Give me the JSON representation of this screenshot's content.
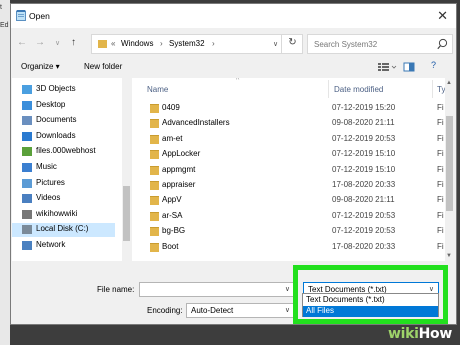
{
  "window": {
    "title": "Open"
  },
  "edge_text": [
    "t",
    "Ed"
  ],
  "address": {
    "crumbs": [
      "Windows",
      "System32"
    ]
  },
  "search": {
    "placeholder": "Search System32"
  },
  "toolbar": {
    "organize_label": "Organize ▾",
    "new_folder_label": "New folder"
  },
  "nav_items": [
    {
      "label": "3D Objects",
      "icon": "cube-icon",
      "color": "#4a9fe0"
    },
    {
      "label": "Desktop",
      "icon": "desktop-icon",
      "color": "#3b8edb"
    },
    {
      "label": "Documents",
      "icon": "documents-icon",
      "color": "#6a8fbf"
    },
    {
      "label": "Downloads",
      "icon": "download-icon",
      "color": "#2a7ad0"
    },
    {
      "label": "files.000webhost",
      "icon": "network-drive-icon",
      "color": "#5aa03a"
    },
    {
      "label": "Music",
      "icon": "music-icon",
      "color": "#3b7fd0"
    },
    {
      "label": "Pictures",
      "icon": "pictures-icon",
      "color": "#5b9bd5"
    },
    {
      "label": "Videos",
      "icon": "videos-icon",
      "color": "#4a7fc0"
    },
    {
      "label": "wikihowwiki",
      "icon": "drive-icon",
      "color": "#777777"
    },
    {
      "label": "Local Disk (C:)",
      "icon": "disk-icon",
      "color": "#7a8a99",
      "selected": true
    },
    {
      "label": "Network",
      "icon": "network-icon",
      "color": "#4a80c0"
    }
  ],
  "columns": {
    "name": "Name",
    "date": "Date modified",
    "type": "Ty"
  },
  "files": [
    {
      "name": "0409",
      "date": "07-12-2019 15:20",
      "type": "Fi"
    },
    {
      "name": "AdvancedInstallers",
      "date": "09-08-2020 21:11",
      "type": "Fi"
    },
    {
      "name": "am-et",
      "date": "07-12-2019 20:53",
      "type": "Fi"
    },
    {
      "name": "AppLocker",
      "date": "07-12-2019 15:10",
      "type": "Fi"
    },
    {
      "name": "appmgmt",
      "date": "07-12-2019 15:10",
      "type": "Fi"
    },
    {
      "name": "appraiser",
      "date": "17-08-2020 20:33",
      "type": "Fi"
    },
    {
      "name": "AppV",
      "date": "09-08-2020 21:11",
      "type": "Fi"
    },
    {
      "name": "ar-SA",
      "date": "07-12-2019 20:53",
      "type": "Fi"
    },
    {
      "name": "bg-BG",
      "date": "07-12-2019 20:53",
      "type": "Fi"
    },
    {
      "name": "Boot",
      "date": "17-08-2020 20:33",
      "type": "Fi"
    }
  ],
  "filename": {
    "label": "File name:",
    "value": ""
  },
  "encoding": {
    "label": "Encoding:",
    "value": "Auto-Detect"
  },
  "filetype": {
    "selected": "Text Documents (*.txt)",
    "options": [
      "Text Documents (*.txt)",
      "All Files"
    ],
    "highlighted": "All Files"
  },
  "colors": {
    "highlight": "#22e01e",
    "selection": "#0078d7",
    "folder": "#e2b54a"
  },
  "watermark": {
    "prefix": "wiki",
    "suffix": "How"
  }
}
